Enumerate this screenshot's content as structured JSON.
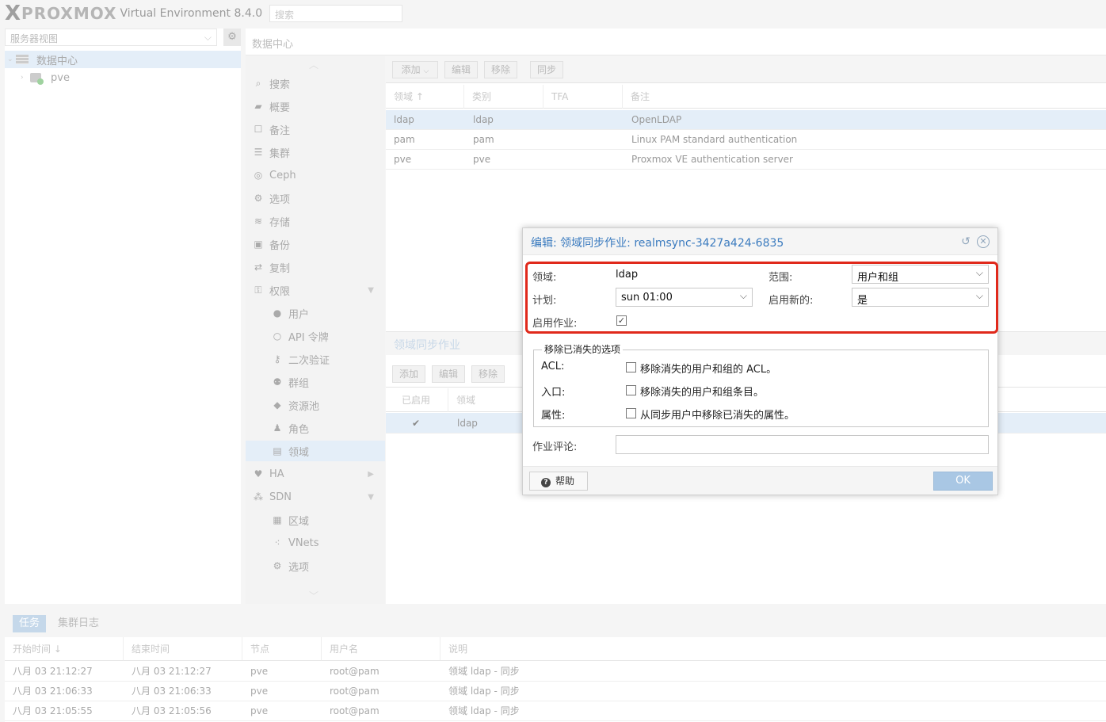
{
  "header": {
    "logo_x": "X",
    "logo_brand": "PROXMOX",
    "version": "Virtual Environment 8.4.0",
    "search_placeholder": "搜索"
  },
  "tree": {
    "view_label": "服务器视图",
    "items": [
      {
        "label": "数据中心",
        "icon": "datacenter-icon"
      },
      {
        "label": "pve",
        "icon": "node-icon"
      }
    ]
  },
  "breadcrumb": "数据中心",
  "nav": {
    "items": [
      {
        "label": "搜索",
        "icon": "search-icon",
        "glyph": "⌕"
      },
      {
        "label": "概要",
        "icon": "book-icon",
        "glyph": "▰"
      },
      {
        "label": "备注",
        "icon": "note-icon",
        "glyph": "☐"
      },
      {
        "label": "集群",
        "icon": "server-icon",
        "glyph": "☰"
      },
      {
        "label": "Ceph",
        "icon": "ceph-icon",
        "glyph": "◎"
      },
      {
        "label": "选项",
        "icon": "gear-icon",
        "glyph": "⚙"
      },
      {
        "label": "存储",
        "icon": "database-icon",
        "glyph": "≋"
      },
      {
        "label": "备份",
        "icon": "floppy-icon",
        "glyph": "▣"
      },
      {
        "label": "复制",
        "icon": "retweet-icon",
        "glyph": "⇄"
      },
      {
        "label": "权限",
        "icon": "unlock-icon",
        "glyph": "⚿"
      },
      {
        "label": "用户",
        "icon": "user-icon",
        "glyph": "●"
      },
      {
        "label": "API 令牌",
        "icon": "user-outline-icon",
        "glyph": "○"
      },
      {
        "label": "二次验证",
        "icon": "key-icon",
        "glyph": "⚷"
      },
      {
        "label": "群组",
        "icon": "users-icon",
        "glyph": "⚉"
      },
      {
        "label": "资源池",
        "icon": "tags-icon",
        "glyph": "◆"
      },
      {
        "label": "角色",
        "icon": "male-icon",
        "glyph": "♟"
      },
      {
        "label": "领域",
        "icon": "address-book-icon",
        "glyph": "▤"
      },
      {
        "label": "HA",
        "icon": "heartbeat-icon",
        "glyph": "♥"
      },
      {
        "label": "SDN",
        "icon": "sdn-icon",
        "glyph": "⁂"
      },
      {
        "label": "区域",
        "icon": "th-icon",
        "glyph": "▦"
      },
      {
        "label": "VNets",
        "icon": "network-icon",
        "glyph": "⁖"
      },
      {
        "label": "选项",
        "icon": "gear-icon",
        "glyph": "⚙"
      }
    ]
  },
  "realms_toolbar": {
    "add": "添加",
    "edit": "编辑",
    "remove": "移除",
    "sync": "同步"
  },
  "realms_grid": {
    "columns": [
      "领域 ↑",
      "类别",
      "TFA",
      "备注"
    ],
    "rows": [
      {
        "realm": "ldap",
        "type": "ldap",
        "tfa": "",
        "comment": "OpenLDAP"
      },
      {
        "realm": "pam",
        "type": "pam",
        "tfa": "",
        "comment": "Linux PAM standard authentication"
      },
      {
        "realm": "pve",
        "type": "pve",
        "tfa": "",
        "comment": "Proxmox VE authentication server"
      }
    ]
  },
  "sync_section": {
    "title": "领域同步作业",
    "add": "添加",
    "edit": "编辑",
    "remove": "移除",
    "columns": [
      "已启用",
      "领域"
    ],
    "rows": [
      {
        "enabled": "✔",
        "realm": "ldap"
      }
    ]
  },
  "tasks": {
    "tabs": [
      "任务",
      "集群日志"
    ],
    "columns": [
      "开始时间 ↓",
      "结束时间",
      "节点",
      "用户名",
      "说明"
    ],
    "rows": [
      {
        "start": "八月 03 21:12:27",
        "end": "八月 03 21:12:27",
        "node": "pve",
        "user": "root@pam",
        "desc": "领域 ldap - 同步"
      },
      {
        "start": "八月 03 21:06:33",
        "end": "八月 03 21:06:33",
        "node": "pve",
        "user": "root@pam",
        "desc": "领域 ldap - 同步"
      },
      {
        "start": "八月 03 21:05:55",
        "end": "八月 03 21:05:56",
        "node": "pve",
        "user": "root@pam",
        "desc": "领域 ldap - 同步"
      }
    ]
  },
  "modal": {
    "title": "编辑: 领域同步作业: realmsync-3427a424-6835",
    "realm_label": "领域:",
    "realm_value": "ldap",
    "scope_label": "范围:",
    "scope_value": "用户和组",
    "schedule_label": "计划:",
    "schedule_value": "sun 01:00",
    "enable_new_label": "启用新的:",
    "enable_new_value": "是",
    "enable_job_label": "启用作业:",
    "enable_job_checked": true,
    "remove_vanished_legend": "移除已消失的选项",
    "acl_label": "ACL:",
    "acl_text": "移除消失的用户和组的 ACL。",
    "entry_label": "入口:",
    "entry_text": "移除消失的用户和组条目。",
    "props_label": "属性:",
    "props_text": "从同步用户中移除已消失的属性。",
    "comment_label": "作业评论:",
    "comment_value": "",
    "help_label": "帮助",
    "ok_label": "OK"
  },
  "colors": {
    "title_blue": "#3b7bbf",
    "highlight_red": "#e0291b",
    "selection": "#e4eef8",
    "ok_button": "#a9c7e4"
  }
}
